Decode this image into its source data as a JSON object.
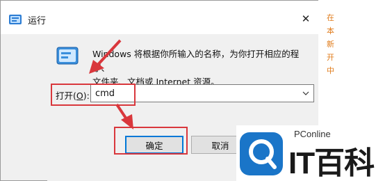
{
  "window": {
    "title": "运行",
    "close_glyph": "✕"
  },
  "dialog": {
    "description_line1": "Windows 将根据你所输入的名称，为你打开相应的程序、",
    "description_line2": "文件夹、文档或 Internet 资源。",
    "open_label_prefix": "打开(",
    "open_label_hotkey": "O",
    "open_label_suffix": "):",
    "input_value": "cmd",
    "buttons": {
      "ok": "确定",
      "cancel": "取消",
      "browse": ""
    }
  },
  "watermark": {
    "small": "PConline",
    "big": "IT百科"
  },
  "side_text": [
    "在",
    "本",
    "新",
    "开",
    "中"
  ],
  "colors": {
    "annotation": "#d9373c",
    "focus_border": "#0078d7",
    "side_text": "#e07b1a",
    "watermark_blue": "#1a75c8"
  },
  "icons": {
    "title": "run-app-icon",
    "run": "run-dialog-icon",
    "close": "close-icon",
    "dropdown": "chevron-down-icon",
    "watermark": "search-magnifier-icon",
    "arrow": "red-arrow-icon"
  }
}
